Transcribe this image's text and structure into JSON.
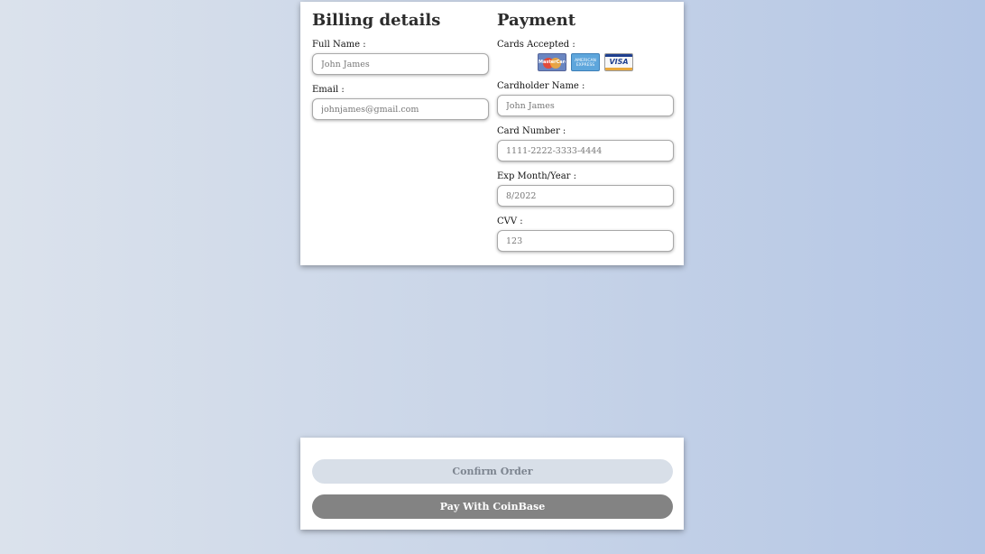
{
  "billing": {
    "heading": "Billing details",
    "full_name_label": "Full Name :",
    "full_name_placeholder": "John James",
    "email_label": "Email :",
    "email_placeholder": "johnjames@gmail.com"
  },
  "payment": {
    "heading": "Payment",
    "cards_label": "Cards Accepted :",
    "cards": [
      {
        "name": "mastercard-icon",
        "text": "MasterCard"
      },
      {
        "name": "amex-icon",
        "text": "AMERICAN EXPRESS"
      },
      {
        "name": "visa-icon",
        "text": "VISA"
      }
    ],
    "cardholder_label": "Cardholder Name :",
    "cardholder_placeholder": "John James",
    "card_number_label": "Card Number :",
    "card_number_placeholder": "1111-2222-3333-4444",
    "exp_label": "Exp Month/Year :",
    "exp_placeholder": "8/2022",
    "cvv_label": "CVV :",
    "cvv_placeholder": "123"
  },
  "actions": {
    "confirm_label": "Confirm Order",
    "coinbase_label": "Pay With CoinBase"
  },
  "colors": {
    "confirm_bg": "#d8dfe8",
    "coinbase_bg": "#838383"
  }
}
